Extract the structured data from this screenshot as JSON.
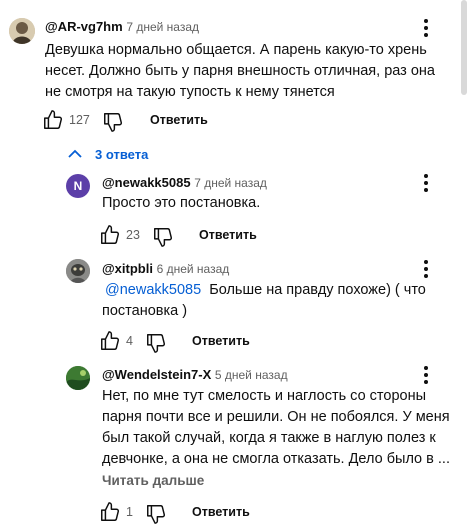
{
  "comment": {
    "author": "@AR-vg7hm",
    "time": "7 дней назад",
    "text_lines": [
      "Девушка нормально общается. А парень какую-то хрень",
      "несет. Должно быть у парня внешность отличная, раз она",
      "не смотря на такую тупость к нему тянется"
    ],
    "likes": "127",
    "reply_label": "Ответить"
  },
  "replies_toggle": {
    "label": "3 ответа"
  },
  "replies": [
    {
      "author": "@newakk5085",
      "time": "7 дней назад",
      "avatar_letter": "N",
      "text_lines": [
        "Просто это постановка."
      ],
      "likes": "23",
      "reply_label": "Ответить"
    },
    {
      "author": "@xitpbli",
      "time": "6 дней назад",
      "mention": "@newakk5085",
      "text_first_rest": "  Больше на правду похоже) ( что",
      "text_lines": [
        "постановка )"
      ],
      "likes": "4",
      "reply_label": "Ответить"
    },
    {
      "author": "@Wendelstein7-X",
      "time": "5 дней назад",
      "text_lines": [
        "Нет, по мне тут смелость и наглость со стороны",
        "парня почти все и решили. Он не побоялся. У меня",
        "был такой случай, когда я также в наглую полез к",
        "девчонке, а она не смогла отказать. Дело было в ..."
      ],
      "read_more": "Читать дальше",
      "likes": "1",
      "reply_label": "Ответить"
    }
  ],
  "colors": {
    "link": "#065fd4",
    "avatar_n": "#5c3fa8",
    "text": "#0f0f0f",
    "muted": "#606060"
  },
  "icons": [
    "like-icon",
    "dislike-icon",
    "more-vert-icon",
    "chevron-up-icon"
  ]
}
